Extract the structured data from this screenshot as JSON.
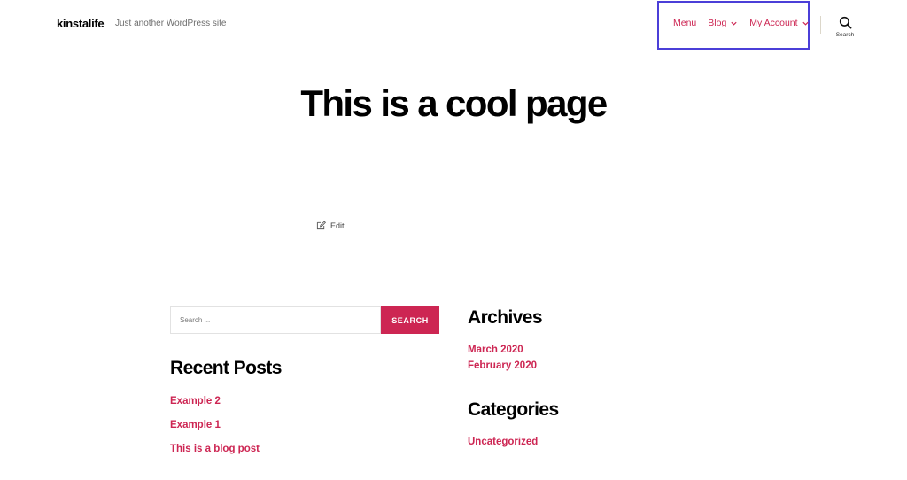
{
  "header": {
    "site_title": "kinstalife",
    "site_description": "Just another WordPress site",
    "nav": {
      "menu_label": "Menu",
      "blog_label": "Blog",
      "account_label": "My Account"
    },
    "search_toggle_label": "Search"
  },
  "main": {
    "page_title": "This is a cool page",
    "edit_label": "Edit"
  },
  "footer_widgets": {
    "search": {
      "placeholder": "Search ...",
      "button_label": "SEARCH"
    },
    "recent_posts": {
      "title": "Recent Posts",
      "items": [
        "Example 2",
        "Example 1",
        "This is a blog post"
      ]
    },
    "archives": {
      "title": "Archives",
      "items": [
        "March 2020",
        "February 2020"
      ]
    },
    "categories": {
      "title": "Categories",
      "items": [
        "Uncategorized"
      ]
    }
  },
  "colors": {
    "accent": "#cd2653",
    "highlight_box": "#4b3fd8",
    "text": "#000000",
    "muted": "#6d6d6d"
  },
  "icons": [
    "chevron-down-icon",
    "search-icon",
    "edit-icon"
  ]
}
